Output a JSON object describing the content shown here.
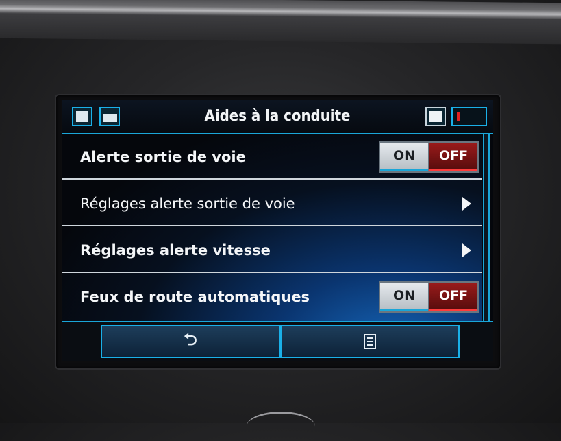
{
  "header": {
    "title": "Aides à la conduite",
    "left_icons": [
      "book-icon",
      "car-info-icon"
    ],
    "right_icons": [
      "note-icon",
      "battery-status-icon"
    ]
  },
  "settings": [
    {
      "label": "Alerte sortie de voie",
      "type": "toggle",
      "on_label": "ON",
      "off_label": "OFF",
      "state": "OFF"
    },
    {
      "label": "Réglages alerte sortie de voie",
      "type": "submenu",
      "icon": "chevron-right-icon"
    },
    {
      "label": "Réglages alerte vitesse",
      "type": "submenu",
      "icon": "chevron-right-icon"
    },
    {
      "label": "Feux de route automatiques",
      "type": "toggle",
      "on_label": "ON",
      "off_label": "OFF",
      "state": "OFF"
    }
  ],
  "footer": {
    "back_icon": "return-arrow-icon",
    "back_symbol": "⮌",
    "menu_icon": "menu-list-icon"
  },
  "colors": {
    "accent": "#1aa6d8",
    "off_active": "#9a1b1b",
    "text": "#f4f6f8"
  }
}
